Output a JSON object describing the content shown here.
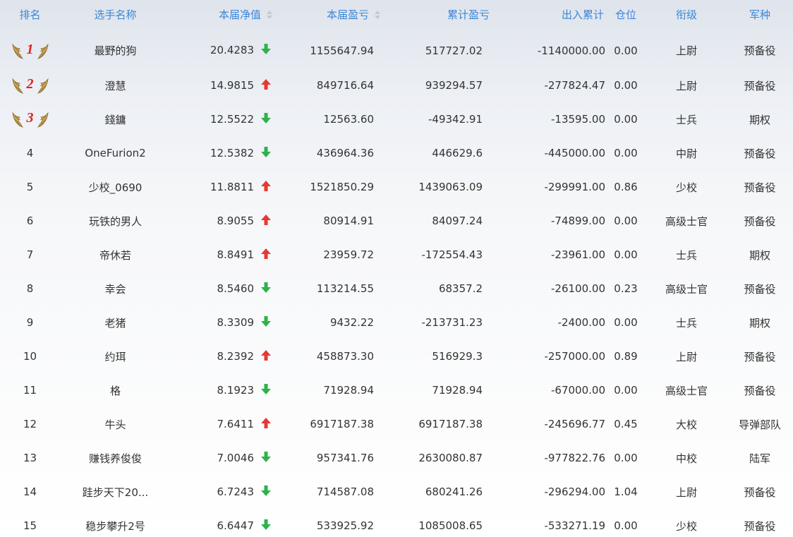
{
  "headers": {
    "rank": "排名",
    "name": "选手名称",
    "nav": "本届净值",
    "pnl": "本届盈亏",
    "total_pnl": "累计盈亏",
    "flow": "出入累计",
    "position": "仓位",
    "grade": "衔级",
    "branch": "军种"
  },
  "colors": {
    "header": "#3b86d8",
    "up": "#e53935",
    "down": "#2db24a",
    "medal": "#c9a55a",
    "medal_number": "#e02020"
  },
  "rows": [
    {
      "rank": "1",
      "name": "最野的狗",
      "nav": "20.4283",
      "trend": "down",
      "pnl": "1155647.94",
      "total_pnl": "517727.02",
      "flow": "-1140000.00",
      "position": "0.00",
      "grade": "上尉",
      "branch": "预备役",
      "medal": true
    },
    {
      "rank": "2",
      "name": "澄慧",
      "nav": "14.9815",
      "trend": "up",
      "pnl": "849716.64",
      "total_pnl": "939294.57",
      "flow": "-277824.47",
      "position": "0.00",
      "grade": "上尉",
      "branch": "预备役",
      "medal": true
    },
    {
      "rank": "3",
      "name": "錢鏞",
      "nav": "12.5522",
      "trend": "down",
      "pnl": "12563.60",
      "total_pnl": "-49342.91",
      "flow": "-13595.00",
      "position": "0.00",
      "grade": "士兵",
      "branch": "期权",
      "medal": true
    },
    {
      "rank": "4",
      "name": "OneFurion2",
      "nav": "12.5382",
      "trend": "down",
      "pnl": "436964.36",
      "total_pnl": "446629.6",
      "flow": "-445000.00",
      "position": "0.00",
      "grade": "中尉",
      "branch": "预备役",
      "medal": false
    },
    {
      "rank": "5",
      "name": "少校_0690",
      "nav": "11.8811",
      "trend": "up",
      "pnl": "1521850.29",
      "total_pnl": "1439063.09",
      "flow": "-299991.00",
      "position": "0.86",
      "grade": "少校",
      "branch": "预备役",
      "medal": false
    },
    {
      "rank": "6",
      "name": "玩铁的男人",
      "nav": "8.9055",
      "trend": "up",
      "pnl": "80914.91",
      "total_pnl": "84097.24",
      "flow": "-74899.00",
      "position": "0.00",
      "grade": "高级士官",
      "branch": "预备役",
      "medal": false
    },
    {
      "rank": "7",
      "name": "帝休若",
      "nav": "8.8491",
      "trend": "up",
      "pnl": "23959.72",
      "total_pnl": "-172554.43",
      "flow": "-23961.00",
      "position": "0.00",
      "grade": "士兵",
      "branch": "期权",
      "medal": false
    },
    {
      "rank": "8",
      "name": "幸会",
      "nav": "8.5460",
      "trend": "down",
      "pnl": "113214.55",
      "total_pnl": "68357.2",
      "flow": "-26100.00",
      "position": "0.23",
      "grade": "高级士官",
      "branch": "预备役",
      "medal": false
    },
    {
      "rank": "9",
      "name": "老猪",
      "nav": "8.3309",
      "trend": "down",
      "pnl": "9432.22",
      "total_pnl": "-213731.23",
      "flow": "-2400.00",
      "position": "0.00",
      "grade": "士兵",
      "branch": "期权",
      "medal": false
    },
    {
      "rank": "10",
      "name": "约珥",
      "nav": "8.2392",
      "trend": "up",
      "pnl": "458873.30",
      "total_pnl": "516929.3",
      "flow": "-257000.00",
      "position": "0.89",
      "grade": "上尉",
      "branch": "预备役",
      "medal": false
    },
    {
      "rank": "11",
      "name": "格",
      "nav": "8.1923",
      "trend": "down",
      "pnl": "71928.94",
      "total_pnl": "71928.94",
      "flow": "-67000.00",
      "position": "0.00",
      "grade": "高级士官",
      "branch": "预备役",
      "medal": false
    },
    {
      "rank": "12",
      "name": "牛头",
      "nav": "7.6411",
      "trend": "up",
      "pnl": "6917187.38",
      "total_pnl": "6917187.38",
      "flow": "-245696.77",
      "position": "0.45",
      "grade": "大校",
      "branch": "导弹部队",
      "medal": false
    },
    {
      "rank": "13",
      "name": "赚钱养俊俊",
      "nav": "7.0046",
      "trend": "down",
      "pnl": "957341.76",
      "total_pnl": "2630080.87",
      "flow": "-977822.76",
      "position": "0.00",
      "grade": "中校",
      "branch": "陆军",
      "medal": false
    },
    {
      "rank": "14",
      "name": "跬步天下20...",
      "nav": "6.7243",
      "trend": "down",
      "pnl": "714587.08",
      "total_pnl": "680241.26",
      "flow": "-296294.00",
      "position": "1.04",
      "grade": "上尉",
      "branch": "预备役",
      "medal": false
    },
    {
      "rank": "15",
      "name": "稳步攀升2号",
      "nav": "6.6447",
      "trend": "down",
      "pnl": "533925.92",
      "total_pnl": "1085008.65",
      "flow": "-533271.19",
      "position": "0.00",
      "grade": "少校",
      "branch": "预备役",
      "medal": false
    }
  ]
}
